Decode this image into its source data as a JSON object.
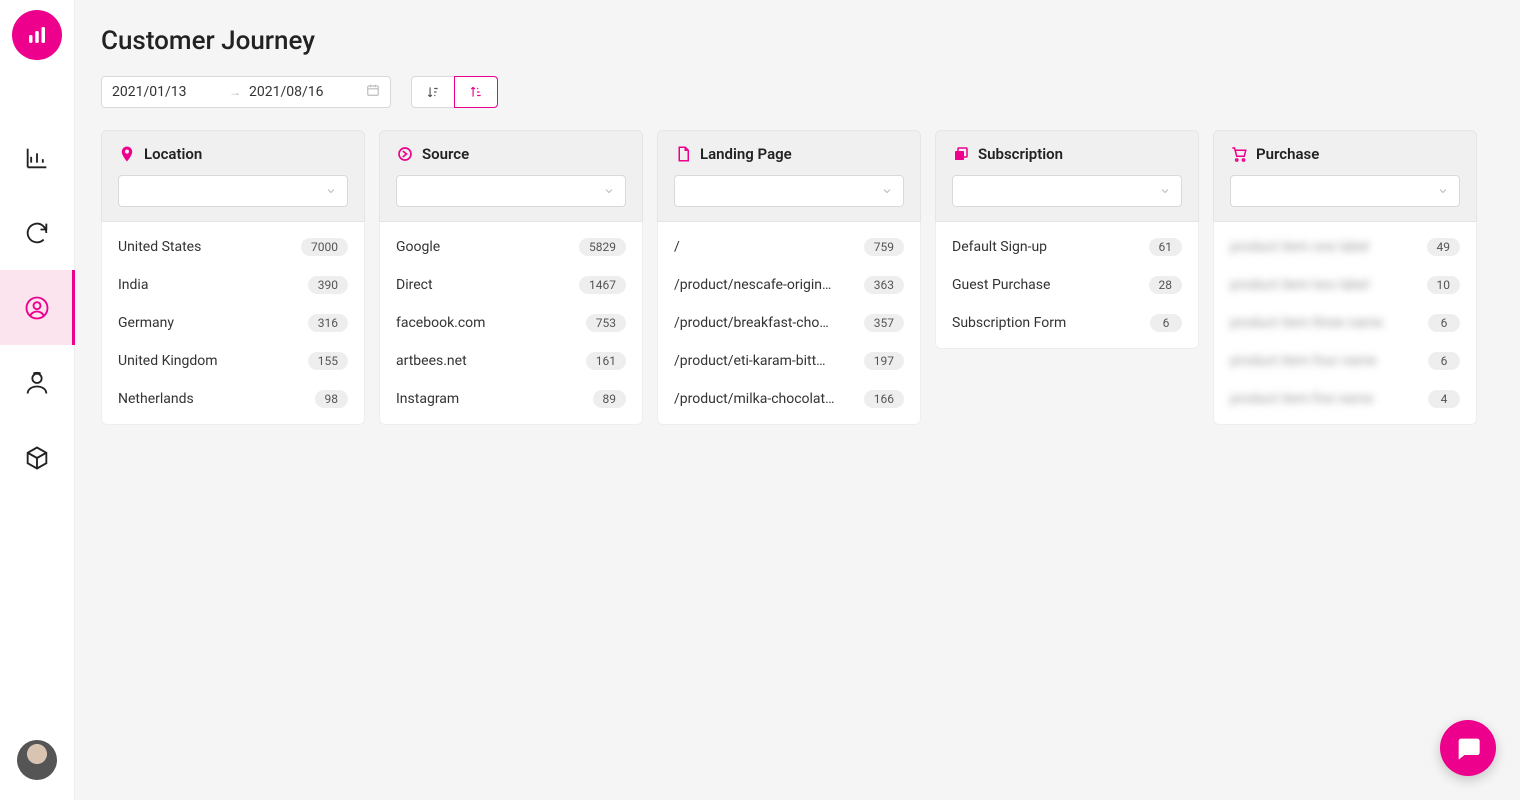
{
  "page": {
    "title": "Customer Journey"
  },
  "dateRange": {
    "start": "2021/01/13",
    "end": "2021/08/16"
  },
  "columns": {
    "location": {
      "title": "Location",
      "items": [
        {
          "label": "United States",
          "count": "7000"
        },
        {
          "label": "India",
          "count": "390"
        },
        {
          "label": "Germany",
          "count": "316"
        },
        {
          "label": "United Kingdom",
          "count": "155"
        },
        {
          "label": "Netherlands",
          "count": "98"
        }
      ]
    },
    "source": {
      "title": "Source",
      "items": [
        {
          "label": "Google",
          "count": "5829"
        },
        {
          "label": "Direct",
          "count": "1467"
        },
        {
          "label": "facebook.com",
          "count": "753"
        },
        {
          "label": "artbees.net",
          "count": "161"
        },
        {
          "label": "Instagram",
          "count": "89"
        }
      ]
    },
    "landing": {
      "title": "Landing Page",
      "items": [
        {
          "label": "/",
          "count": "759"
        },
        {
          "label": "/product/nescafe-origin…",
          "count": "363"
        },
        {
          "label": "/product/breakfast-cho…",
          "count": "357"
        },
        {
          "label": "/product/eti-karam-bitt…",
          "count": "197"
        },
        {
          "label": "/product/milka-chocolat…",
          "count": "166"
        }
      ]
    },
    "subscription": {
      "title": "Subscription",
      "items": [
        {
          "label": "Default Sign-up",
          "count": "61"
        },
        {
          "label": "Guest Purchase",
          "count": "28"
        },
        {
          "label": "Subscription Form",
          "count": "6"
        }
      ]
    },
    "purchase": {
      "title": "Purchase",
      "items": [
        {
          "label": "product item one label",
          "count": "49"
        },
        {
          "label": "product item two label",
          "count": "10"
        },
        {
          "label": "product item three name",
          "count": "6"
        },
        {
          "label": "product item four name",
          "count": "6"
        },
        {
          "label": "product item five name",
          "count": "4"
        }
      ]
    }
  }
}
